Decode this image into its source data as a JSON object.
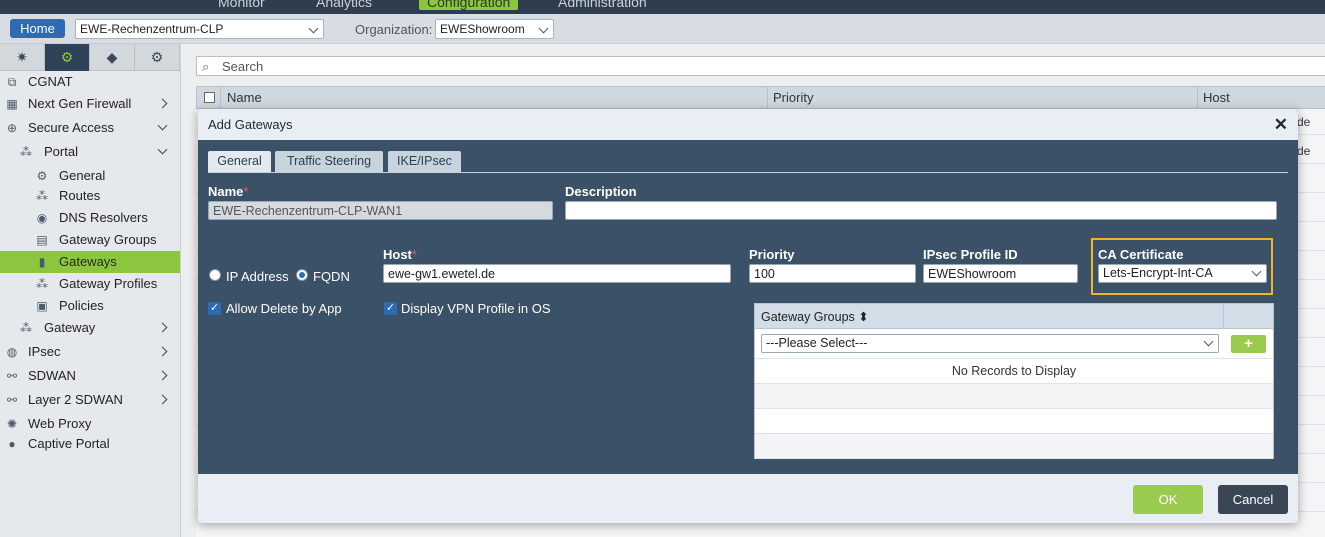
{
  "topnav": {
    "items": [
      "Monitor",
      "Analytics",
      "Configuration",
      "Administration"
    ],
    "active": "Configuration"
  },
  "secbar": {
    "home_label": "Home",
    "appliance_value": "EWE-Rechenzentrum-CLP",
    "org_label": "Organization:",
    "org_value": "EWEShowroom"
  },
  "sidebar": {
    "tabs": [
      "network-icon",
      "gear-icon",
      "cube-icon",
      "gear-user-icon"
    ],
    "active_tab": 1,
    "items": [
      {
        "label": "CGNAT",
        "icon": "cgnat-icon",
        "level": 0
      },
      {
        "label": "Next Gen Firewall",
        "icon": "firewall-icon",
        "level": 0,
        "arrow": "right"
      },
      {
        "label": "Secure Access",
        "icon": "globe-icon",
        "level": 0,
        "arrow": "down"
      },
      {
        "label": "Portal",
        "icon": "nodes-icon",
        "level": 1,
        "arrow": "down"
      },
      {
        "label": "General",
        "icon": "gear-icon",
        "level": 2
      },
      {
        "label": "Routes",
        "icon": "routes-icon",
        "level": 2
      },
      {
        "label": "DNS Resolvers",
        "icon": "dns-icon",
        "level": 2
      },
      {
        "label": "Gateway Groups",
        "icon": "gateway-groups-icon",
        "level": 2
      },
      {
        "label": "Gateways",
        "icon": "gateway-icon",
        "level": 2,
        "active": true
      },
      {
        "label": "Gateway Profiles",
        "icon": "nodes-icon",
        "level": 2
      },
      {
        "label": "Policies",
        "icon": "policy-icon",
        "level": 2
      },
      {
        "label": "Gateway",
        "icon": "nodes-icon",
        "level": 1,
        "arrow": "right"
      },
      {
        "label": "IPsec",
        "icon": "ipsec-icon",
        "level": 0,
        "arrow": "right"
      },
      {
        "label": "SDWAN",
        "icon": "sdwan-icon",
        "level": 0,
        "arrow": "right"
      },
      {
        "label": "Layer 2 SDWAN",
        "icon": "sdwan-icon",
        "level": 0,
        "arrow": "right"
      },
      {
        "label": "Web Proxy",
        "icon": "web-proxy-icon",
        "level": 0
      },
      {
        "label": "Captive Portal",
        "icon": "captive-portal-icon",
        "level": 0
      }
    ]
  },
  "background_grid": {
    "search_placeholder": "Search",
    "columns": [
      "Name",
      "Priority",
      "Host"
    ],
    "row_snippets": [
      "de",
      "de"
    ]
  },
  "modal": {
    "title": "Add Gateways",
    "tabs": [
      "General",
      "Traffic Steering",
      "IKE/IPsec"
    ],
    "active_tab": "General",
    "fields": {
      "name_label": "Name",
      "name_value": "EWE-Rechenzentrum-CLP-WAN1",
      "description_label": "Description",
      "description_value": "",
      "host_label": "Host",
      "host_value": "ewe-gw1.ewetel.de",
      "priority_label": "Priority",
      "priority_value": "100",
      "ipsec_profile_label": "IPsec Profile ID",
      "ipsec_profile_value": "EWEShowroom",
      "ca_cert_label": "CA Certificate",
      "ca_cert_value": "Lets-Encrypt-Int-CA",
      "required_mark": "*"
    },
    "address_type": {
      "options": [
        "IP Address",
        "FQDN"
      ],
      "selected": "FQDN"
    },
    "checkboxes": {
      "allow_delete_label": "Allow Delete by App",
      "allow_delete_checked": true,
      "display_vpn_label": "Display VPN Profile in OS",
      "display_vpn_checked": true
    },
    "gateway_groups": {
      "header": "Gateway Groups",
      "select_placeholder": "---Please Select---",
      "add_label": "+",
      "empty_text": "No Records to Display"
    },
    "ok_label": "OK",
    "cancel_label": "Cancel"
  },
  "colors": {
    "accent_green": "#8cc63f",
    "primary_blue": "#2d6bb4",
    "modal_body": "#3b5168",
    "highlight": "#f0b429"
  }
}
